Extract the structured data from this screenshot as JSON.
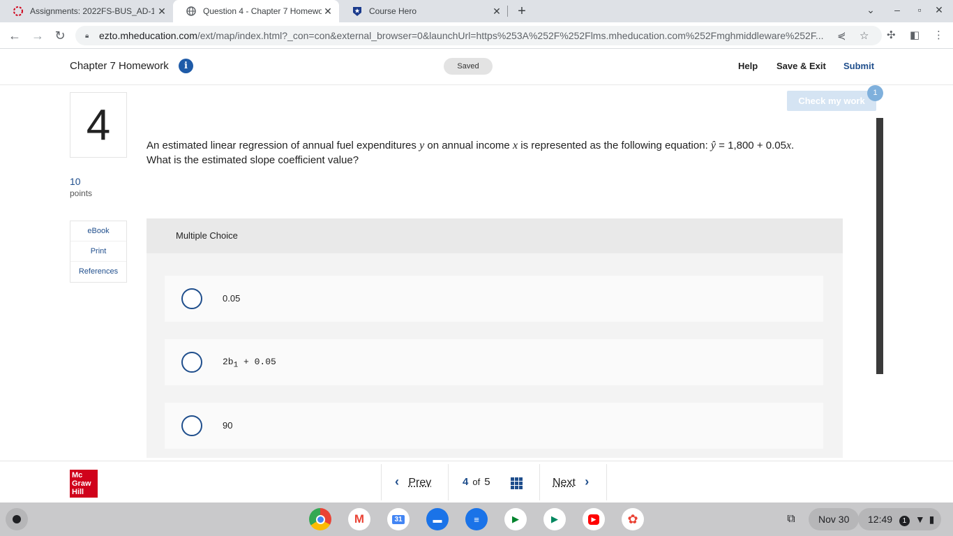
{
  "browser": {
    "tabs": [
      {
        "title": "Assignments: 2022FS-BUS_AD-1",
        "icon": "mcgraw-ring-icon"
      },
      {
        "title": "Question 4 - Chapter 7 Homewor",
        "icon": "globe-icon"
      },
      {
        "title": "Course Hero",
        "icon": "course-hero-icon"
      }
    ],
    "url_host": "ezto.mheducation.com",
    "url_rest": "/ext/map/index.html?_con=con&external_browser=0&launchUrl=https%253A%252F%252Flms.mheducation.com%252Fmghmiddleware%252F..."
  },
  "header": {
    "title": "Chapter 7 Homework",
    "saved": "Saved",
    "help": "Help",
    "save_exit": "Save & Exit",
    "submit": "Submit"
  },
  "question": {
    "number": "4",
    "points_value": "10",
    "points_label": "points",
    "side_links": [
      "eBook",
      "Print",
      "References"
    ],
    "check_my_work": "Check my work",
    "check_badge": "1",
    "text_a": "An estimated linear regression of annual fuel expenditures ",
    "var_y": "y",
    "text_b": " on annual income ",
    "var_x": "x",
    "text_c": " is represented as the following equation: ",
    "yhat": "ŷ",
    "equation": " = 1,800 + 0.05",
    "eq_x": "x",
    "text_d": ".",
    "line2": "What is the estimated slope coefficient value?"
  },
  "multiple_choice": {
    "heading": "Multiple Choice",
    "choices": [
      {
        "label": "0.05"
      },
      {
        "pre": "2b",
        "sub": "1",
        "post": " + 0.05"
      },
      {
        "label": "90"
      }
    ]
  },
  "footer": {
    "logo_lines": [
      "Mc",
      "Graw",
      "Hill"
    ],
    "prev": "Prev",
    "next": "Next",
    "current": "4",
    "of": "of",
    "total": "5"
  },
  "shelf": {
    "date": "Nov 30",
    "time": "12:49",
    "notification_count": "1",
    "apps": [
      "chrome-icon",
      "gmail-icon",
      "calendar-icon",
      "files-icon",
      "messages-icon",
      "meet-icon",
      "play-store-icon",
      "youtube-icon",
      "photos-icon"
    ],
    "calendar_day": "31"
  }
}
